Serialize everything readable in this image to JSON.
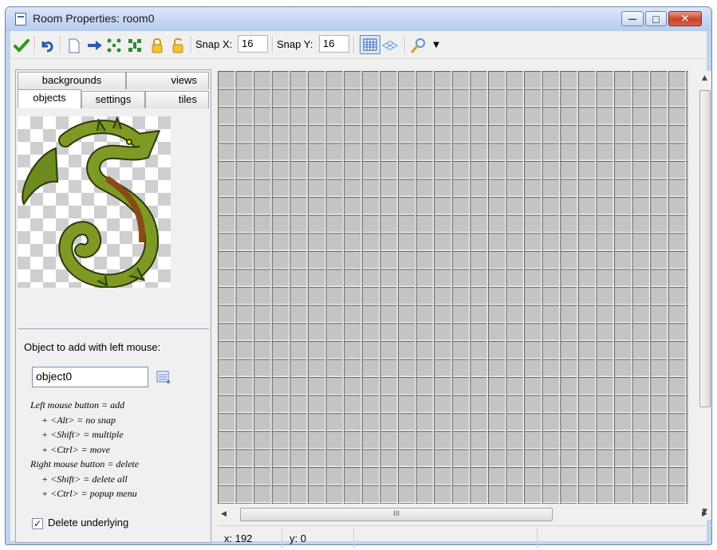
{
  "window": {
    "title": "Room Properties: room0",
    "min_glyph": "—",
    "max_glyph": "□",
    "close_glyph": "✕"
  },
  "toolbar": {
    "snap_x_label": "Snap X:",
    "snap_x_value": "16",
    "snap_y_label": "Snap Y:",
    "snap_y_value": "16",
    "icons": [
      "ok-check-icon",
      "undo-icon",
      "new-document-icon",
      "shift-arrow-icon",
      "expand-icon",
      "contract-icon",
      "lock-icon",
      "unlock-icon",
      "grid-icon",
      "isometric-icon",
      "zoom-icon",
      "dropdown-arrow-icon"
    ]
  },
  "tabs": {
    "row1": [
      "backgrounds",
      "views"
    ],
    "row2": [
      "objects",
      "settings",
      "tiles"
    ],
    "active": "objects"
  },
  "object_panel": {
    "label": "Object to add with left mouse:",
    "selected_object": "object0",
    "help": [
      "Left mouse button = add",
      "+ <Alt> = no snap",
      "+ <Shift> = multiple",
      "+ <Ctrl> = move",
      "Right mouse button = delete",
      "+ <Shift> = delete all",
      "+ <Ctrl> = popup menu"
    ],
    "delete_underlying_label": "Delete underlying",
    "delete_underlying_checked": true
  },
  "scroll": {
    "hthumb_glyph": "III"
  },
  "status": {
    "x": "x: 192",
    "y": "y: 0"
  },
  "colors": {
    "accent_green": "#2f9a1b",
    "undo_blue": "#2a5cb0",
    "grid_fill": "#c4c4c4"
  }
}
